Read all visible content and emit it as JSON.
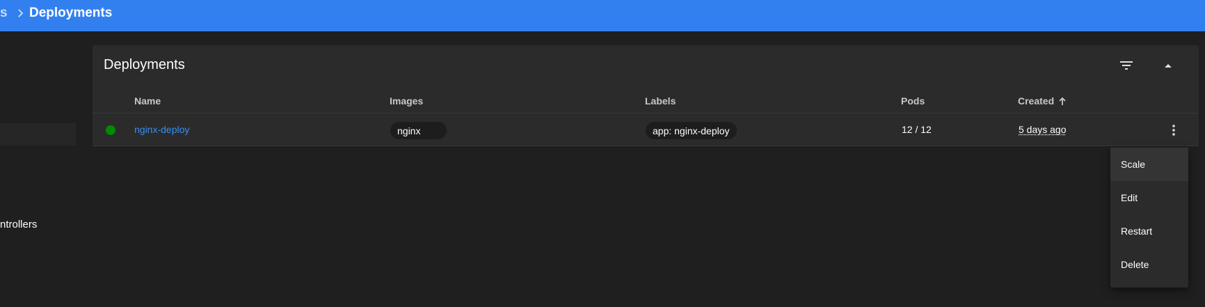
{
  "breadcrumb": {
    "previous": "s",
    "current": "Deployments"
  },
  "sidenav": {
    "visible_item": "ntrollers"
  },
  "card": {
    "title": "Deployments",
    "icons": {
      "filter": "filter-icon",
      "collapse": "chevron-up-icon"
    }
  },
  "table": {
    "columns": [
      "Name",
      "Images",
      "Labels",
      "Pods",
      "Created"
    ],
    "sort_column": "Created",
    "sort_direction": "ascending",
    "rows": [
      {
        "status": "running",
        "name": "nginx-deploy",
        "image": "nginx",
        "label": "app: nginx-deploy",
        "pods": "12 / 12",
        "created": "5 days ago"
      }
    ]
  },
  "menu": {
    "items": [
      "Scale",
      "Edit",
      "Restart",
      "Delete"
    ],
    "highlighted": "Scale"
  },
  "colors": {
    "topbar": "#3280f0",
    "background": "#1f1f1f",
    "card": "#2b2b2b",
    "link": "#3a8ff0",
    "status_ok": "#008a00"
  }
}
